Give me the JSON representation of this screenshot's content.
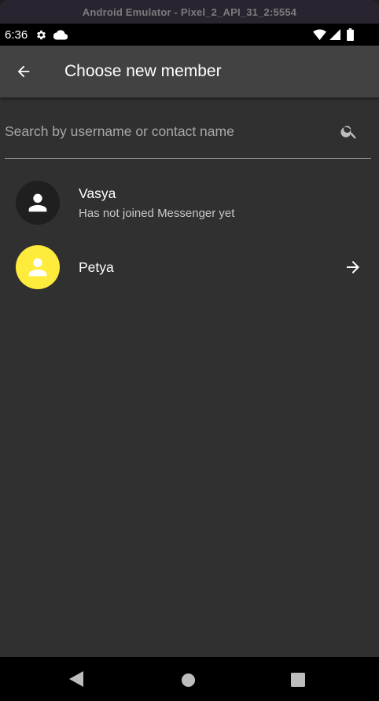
{
  "emulator": {
    "title": "Android Emulator - Pixel_2_API_31_2:5554"
  },
  "status_bar": {
    "time": "6:36",
    "icons": [
      "gear-icon",
      "cloud-icon",
      "wifi-icon",
      "signal-icon",
      "battery-icon"
    ]
  },
  "app_bar": {
    "back_icon": "arrow-back-icon",
    "title": "Choose new member"
  },
  "search": {
    "placeholder": "Search by username or contact name",
    "value": "",
    "icon": "search-icon"
  },
  "contacts": [
    {
      "name": "Vasya",
      "subtitle": "Has not joined Messenger yet",
      "avatar_color": "#1f1f1f",
      "icon": "person-icon",
      "trailing": ""
    },
    {
      "name": "Petya",
      "subtitle": "",
      "avatar_color": "#ffeb3b",
      "icon": "person-icon",
      "trailing": "arrow-forward-icon"
    }
  ],
  "nav_bar": {
    "buttons": [
      "back-triangle-icon",
      "home-circle-icon",
      "recents-square-icon"
    ]
  },
  "colors": {
    "background": "#303030",
    "app_bar": "#424242",
    "accent_avatar": "#ffeb3b"
  }
}
